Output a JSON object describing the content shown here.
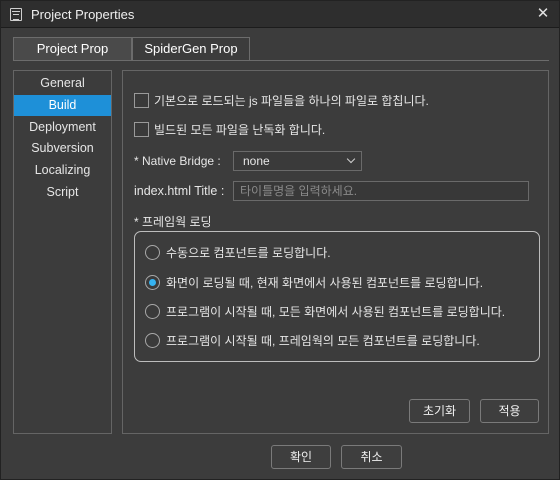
{
  "window": {
    "title": "Project Properties",
    "close_glyph": "✕"
  },
  "tabs": [
    {
      "label": "Project Prop",
      "active": true
    },
    {
      "label": "SpiderGen Prop",
      "active": false
    }
  ],
  "sidebar": {
    "items": [
      {
        "label": "General"
      },
      {
        "label": "Build",
        "selected": true
      },
      {
        "label": "Deployment"
      },
      {
        "label": "Subversion"
      },
      {
        "label": "Localizing"
      },
      {
        "label": "Script"
      }
    ]
  },
  "build": {
    "merge_js_label": "기본으로 로드되는 js 파일들을 하나의 파일로 합칩니다.",
    "merge_js_checked": false,
    "obfuscate_label": "빌드된 모든 파일을 난독화 합니다.",
    "obfuscate_checked": false,
    "native_bridge_label": "* Native Bridge :",
    "native_bridge_value": "none",
    "index_title_label": "index.html Title :",
    "index_title_value": "",
    "index_title_placeholder": "타이틀명을 입력하세요.",
    "framework_loading_label": "* 프레임웍 로딩",
    "options": [
      {
        "label": "수동으로 컴포넌트를 로딩합니다.",
        "checked": false
      },
      {
        "label": "화면이 로딩될 때, 현재 화면에서 사용된 컴포넌트를 로딩합니다.",
        "checked": true
      },
      {
        "label": "프로그램이 시작될 때, 모든 화면에서 사용된 컴포넌트를 로딩합니다.",
        "checked": false
      },
      {
        "label": "프로그램이 시작될 때, 프레임웍의 모든 컴포넌트를 로딩합니다.",
        "checked": false
      }
    ],
    "reset_label": "초기화",
    "apply_label": "적용"
  },
  "footer": {
    "ok_label": "확인",
    "cancel_label": "취소"
  },
  "colors": {
    "accent": "#1e90d8",
    "radio_dot": "#35b2f0",
    "background": "#3c3c3c"
  }
}
